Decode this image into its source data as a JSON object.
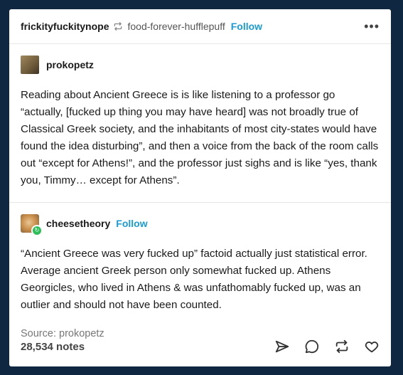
{
  "header": {
    "username": "frickityfuckitynope",
    "reblogged_from": "food-forever-hufflepuff",
    "follow_label": "Follow",
    "more_label": "•••"
  },
  "posts": [
    {
      "username": "prokopetz",
      "text": "Reading about Ancient Greece is is like listening to a professor go “actually, [fucked up thing you may have heard] was not broadly true of Classical Greek society, and the inhabitants of most city-states would have found the idea disturbing”, and then a voice from the back of the room calls out “except for Athens!”, and the professor just sighs and is like “yes, thank you, Timmy… except for Athens”."
    },
    {
      "username": "cheesetheory",
      "follow_label": "Follow",
      "text": "“Ancient Greece was very fucked up” factoid actually just statistical error. Average ancient Greek person only somewhat fucked up. Athens Georgicles, who lived in Athens & was unfathomably fucked up, was an outlier and should not have been counted."
    }
  ],
  "source": "Source: prokopetz",
  "footer": {
    "notes": "28,534 notes",
    "icons": [
      "share-icon",
      "reply-icon",
      "reblog-icon",
      "like-icon"
    ]
  }
}
